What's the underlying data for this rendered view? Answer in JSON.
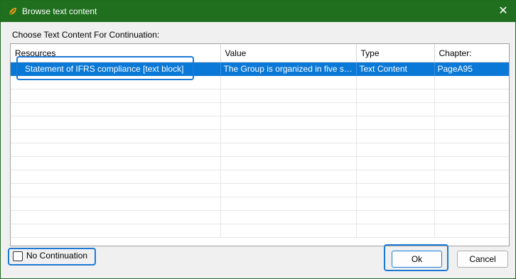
{
  "window": {
    "title": "Browse text content",
    "close_glyph": "✕",
    "app_icon": "leaf-logo-icon",
    "titlebar_color": "#1f6f1f"
  },
  "prompt": "Choose Text Content For Continuation:",
  "table": {
    "columns": [
      "Resources",
      "Value",
      "Type",
      "Chapter:"
    ],
    "rows": [
      {
        "resource": "Statement of IFRS compliance [text block]",
        "value": "The Group is organized in five se...",
        "type": "Text Content",
        "chapter": "PageA95",
        "selected": true
      }
    ]
  },
  "footer": {
    "no_continuation_label": "No Continuation",
    "no_continuation_checked": false,
    "ok_label": "Ok",
    "cancel_label": "Cancel"
  },
  "colors": {
    "selection": "#0a78d7",
    "focus": "#1c7ad6"
  }
}
